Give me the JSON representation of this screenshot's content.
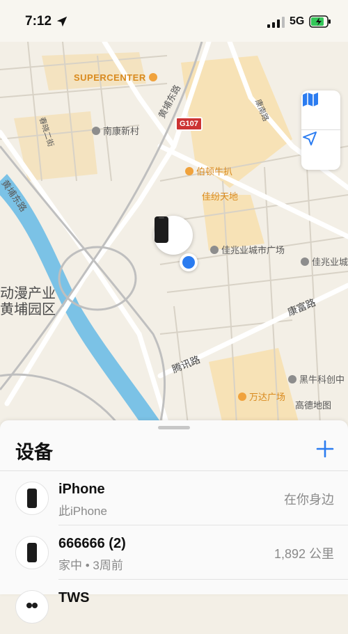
{
  "status_bar": {
    "time": "7:12",
    "network": "5G"
  },
  "map": {
    "labels": {
      "supercenter": "SUPERCENTER",
      "shield_g107": "G107",
      "huangpu_east_1": "黄埔东路",
      "huangpu_east_2": "黄埔东路",
      "nankang_village": "南康新村",
      "chunjing_2nd": "春晓二街",
      "kangnan_road": "康南路",
      "bodun": "伯顿牛扒",
      "jiafen": "佳纷天地",
      "jiazhaoye_plaza": "佳兆业城市广场",
      "jiazhaoye_right": "佳兆业城",
      "animation_1": "动漫产业",
      "animation_2": "黄埔园区",
      "kangfu_road": "康富路",
      "tengxun_road": "腾讯路",
      "heiniu": "黑牛科创中",
      "wanda": "万达广场",
      "amap": "高德地图"
    },
    "accent_color": "#2b7cf0"
  },
  "sheet": {
    "title": "设备",
    "devices": [
      {
        "name": "iPhone",
        "subtitle": "此iPhone",
        "status": "在你身边"
      },
      {
        "name": "666666 (2)",
        "subtitle": "家中 • 3周前",
        "status": "1,892 公里"
      },
      {
        "name": "TWS",
        "subtitle": "",
        "status": ""
      }
    ]
  }
}
